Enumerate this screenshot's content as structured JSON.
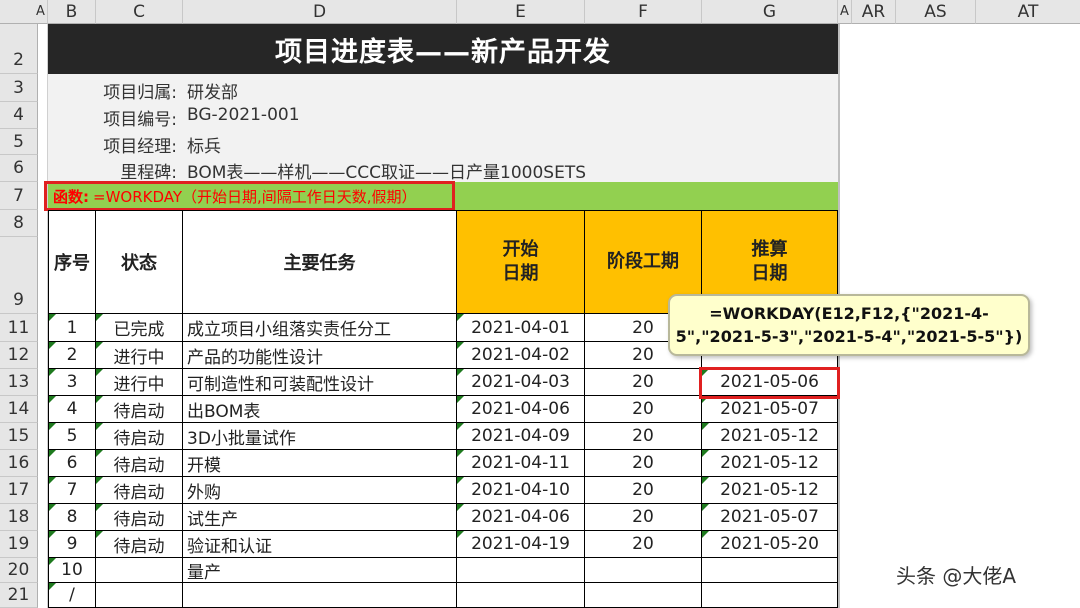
{
  "columns": [
    "A",
    "B",
    "C",
    "D",
    "E",
    "F",
    "G",
    "A",
    "AR",
    "AS",
    "AT"
  ],
  "rows": [
    "2",
    "3",
    "4",
    "5",
    "6",
    "7",
    "8",
    "9",
    "11",
    "12",
    "13",
    "14",
    "15",
    "16",
    "17",
    "18",
    "19",
    "20",
    "21"
  ],
  "title": "项目进度表——新产品开发",
  "info": [
    {
      "label": "项目归属:",
      "value": "研发部"
    },
    {
      "label": "项目编号:",
      "value": "BG-2021-001"
    },
    {
      "label": "项目经理:",
      "value": "标兵"
    },
    {
      "label": "里程碑:",
      "value": "BOM表——样机——CCC取证——日产量1000SETS"
    }
  ],
  "func_label": "函数:",
  "func_text": "=WORKDAY（开始日期,间隔工作日天数,假期）",
  "headers": {
    "seq": "序号",
    "status": "状态",
    "task": "主要任务",
    "start": "开始\n日期",
    "period": "阶段工期",
    "calc": "推算\n日期"
  },
  "tasks": [
    {
      "seq": "1",
      "status": "已完成",
      "task": "成立项目小组落实责任分工",
      "start": "2021-04-01",
      "period": "20",
      "end": ""
    },
    {
      "seq": "2",
      "status": "进行中",
      "task": "产品的功能性设计",
      "start": "2021-04-02",
      "period": "20",
      "end": ""
    },
    {
      "seq": "3",
      "status": "进行中",
      "task": "可制造性和可装配性设计",
      "start": "2021-04-03",
      "period": "20",
      "end": "2021-05-06"
    },
    {
      "seq": "4",
      "status": "待启动",
      "task": "出BOM表",
      "start": "2021-04-06",
      "period": "20",
      "end": "2021-05-07"
    },
    {
      "seq": "5",
      "status": "待启动",
      "task": "3D小批量试作",
      "start": "2021-04-09",
      "period": "20",
      "end": "2021-05-12"
    },
    {
      "seq": "6",
      "status": "待启动",
      "task": "开模",
      "start": "2021-04-11",
      "period": "20",
      "end": "2021-05-12"
    },
    {
      "seq": "7",
      "status": "待启动",
      "task": "外购",
      "start": "2021-04-10",
      "period": "20",
      "end": "2021-05-12"
    },
    {
      "seq": "8",
      "status": "待启动",
      "task": "试生产",
      "start": "2021-04-06",
      "period": "20",
      "end": "2021-05-07"
    },
    {
      "seq": "9",
      "status": "待启动",
      "task": "验证和认证",
      "start": "2021-04-19",
      "period": "20",
      "end": "2021-05-20"
    },
    {
      "seq": "10",
      "status": "",
      "task": "量产",
      "start": "",
      "period": "",
      "end": ""
    },
    {
      "seq": "/",
      "status": "",
      "task": "",
      "start": "",
      "period": "",
      "end": ""
    }
  ],
  "tooltip": {
    "line1": "=WORKDAY(E12,F12,{\"2021-4-",
    "line2": "5\",\"2021-5-3\",\"2021-5-4\",\"2021-5-5\"})"
  },
  "watermark": "头条 @大佬A",
  "colors": {
    "title_bg": "#262626",
    "header_yellow": "#ffc000",
    "func_bar": "#92d050",
    "func_text": "#ff0000",
    "highlight": "#e02020",
    "tooltip_bg": "#ffffcc"
  }
}
